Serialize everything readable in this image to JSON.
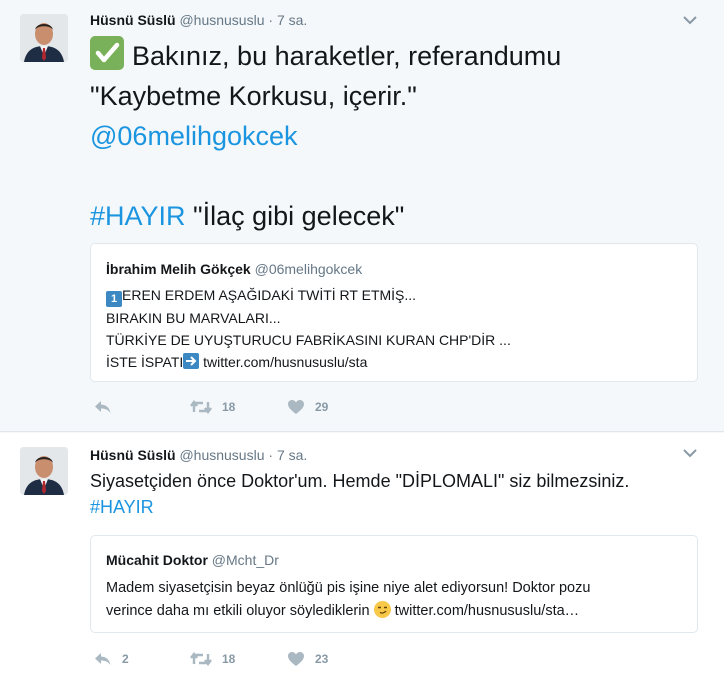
{
  "tweets": [
    {
      "name": "Hüsnü Süslü",
      "handle": "@husnususlu",
      "dot": "·",
      "time": "7 sa.",
      "line1": "Bakınız, bu haraketler, referandumu",
      "line2": "\"Kaybetme Korkusu, içerir.\"",
      "mention": "@06melihgokcek",
      "hashtag": "#HAYIR",
      "line4": " \"İlaç gibi gelecek\"",
      "quote": {
        "name": "İbrahim Melih Gökçek",
        "handle": "@06melihgokcek",
        "line1": "EREN ERDEM AŞAĞIDAKİ TWİTİ RT ETMİŞ...",
        "line2": "BIRAKIN BU MARVALARI...",
        "line3": "TÜRKİYE DE UYUŞTURUCU FABRİKASINI KURAN CHP'DİR ...",
        "line4_text": "İSTE İSPATI",
        "line4_link": "twitter.com/husnususlu/sta",
        "keycap": "1",
        "emoji_keycap": "keycap-one-emoji",
        "emoji_arrow": "right-arrow-emoji"
      },
      "actions": {
        "reply": "",
        "retweet": "18",
        "like": "29"
      },
      "check_emoji": "white-check-mark-emoji"
    },
    {
      "name": "Hüsnü Süslü",
      "handle": "@husnususlu",
      "dot": "·",
      "time": "7 sa.",
      "line1": "Siyasetçiden önce Doktor'um. Hemde \"DİPLOMALI\" siz bilmezsiniz.",
      "hashtag": "#HAYIR",
      "quote": {
        "name": "Mücahit Doktor",
        "handle": "@Mcht_Dr",
        "line1": "Madem siyasetçisin beyaz önlüğü pis işine niye alet ediyorsun! Doktor pozu",
        "line2_text": "verince daha mı etkili oluyor söylediklerin ",
        "line2_link": " twitter.com/husnususlu/sta…",
        "emoji": "smirking-face-emoji"
      },
      "actions": {
        "reply": "2",
        "retweet": "18",
        "like": "23"
      }
    }
  ],
  "colors": {
    "link": "#1b95e0",
    "muted": "#657786",
    "border": "#e1e8ed",
    "bg": "#f5f8fa"
  }
}
